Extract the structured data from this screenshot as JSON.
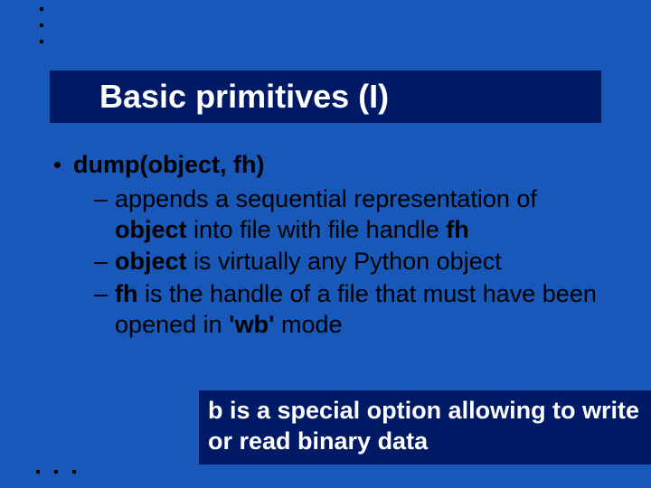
{
  "title": "Basic primitives (I)",
  "bullet": {
    "head_pre": "dump(object,",
    "head_post": "fh)",
    "subs": [
      {
        "dash": "–",
        "pre": "appends a sequential representation of ",
        "b1": "object",
        "mid": " into file with file handle ",
        "b2": "fh",
        "post": ""
      },
      {
        "dash": "–",
        "pre": "",
        "b1": "object",
        "mid": " is virtually any Python object",
        "b2": "",
        "post": ""
      },
      {
        "dash": "–",
        "pre": "",
        "b1": "fh",
        "mid": " is  the handle of a file that must have been opened in ",
        "b2": "'wb'",
        "post": " mode"
      }
    ]
  },
  "note": " b is a special option allowing to write or read binary data"
}
